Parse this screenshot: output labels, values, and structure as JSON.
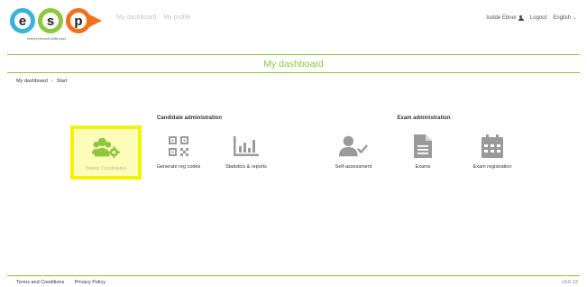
{
  "header": {
    "logo_letters": [
      "e",
      "s",
      "p"
    ],
    "logo_tagline": "entrepreneurial skills pass",
    "nav": [
      "My dashboard",
      "My profile"
    ],
    "user_name": "Isolde Ebner",
    "logout": "Logout",
    "language": "English"
  },
  "title": "My dashboard",
  "breadcrumb": [
    "My dashboard",
    "Start"
  ],
  "candidate_admin": {
    "title": "Candidate administration",
    "tiles": [
      {
        "label": "Status Candidates",
        "icon": "users-gear-icon",
        "active": true
      },
      {
        "label": "Generate reg codes",
        "icon": "qr-code-icon"
      },
      {
        "label": "Statistics & reports",
        "icon": "bar-chart-icon"
      }
    ]
  },
  "exam_admin": {
    "title": "Exam administration",
    "tiles": [
      {
        "label": "Self-assessment",
        "icon": "user-check-icon"
      },
      {
        "label": "Exams",
        "icon": "document-icon"
      },
      {
        "label": "Exam registration",
        "icon": "calendar-icon"
      }
    ]
  },
  "footer": {
    "links": [
      "Terms and Conditions",
      "Privacy Policy"
    ],
    "version": "v3.0.12"
  },
  "colors": {
    "green": "#8dc63f",
    "icon_grey": "#9a9a9a",
    "highlight_border": "#f3f20f",
    "highlight_bg": "#fdfcb9"
  }
}
